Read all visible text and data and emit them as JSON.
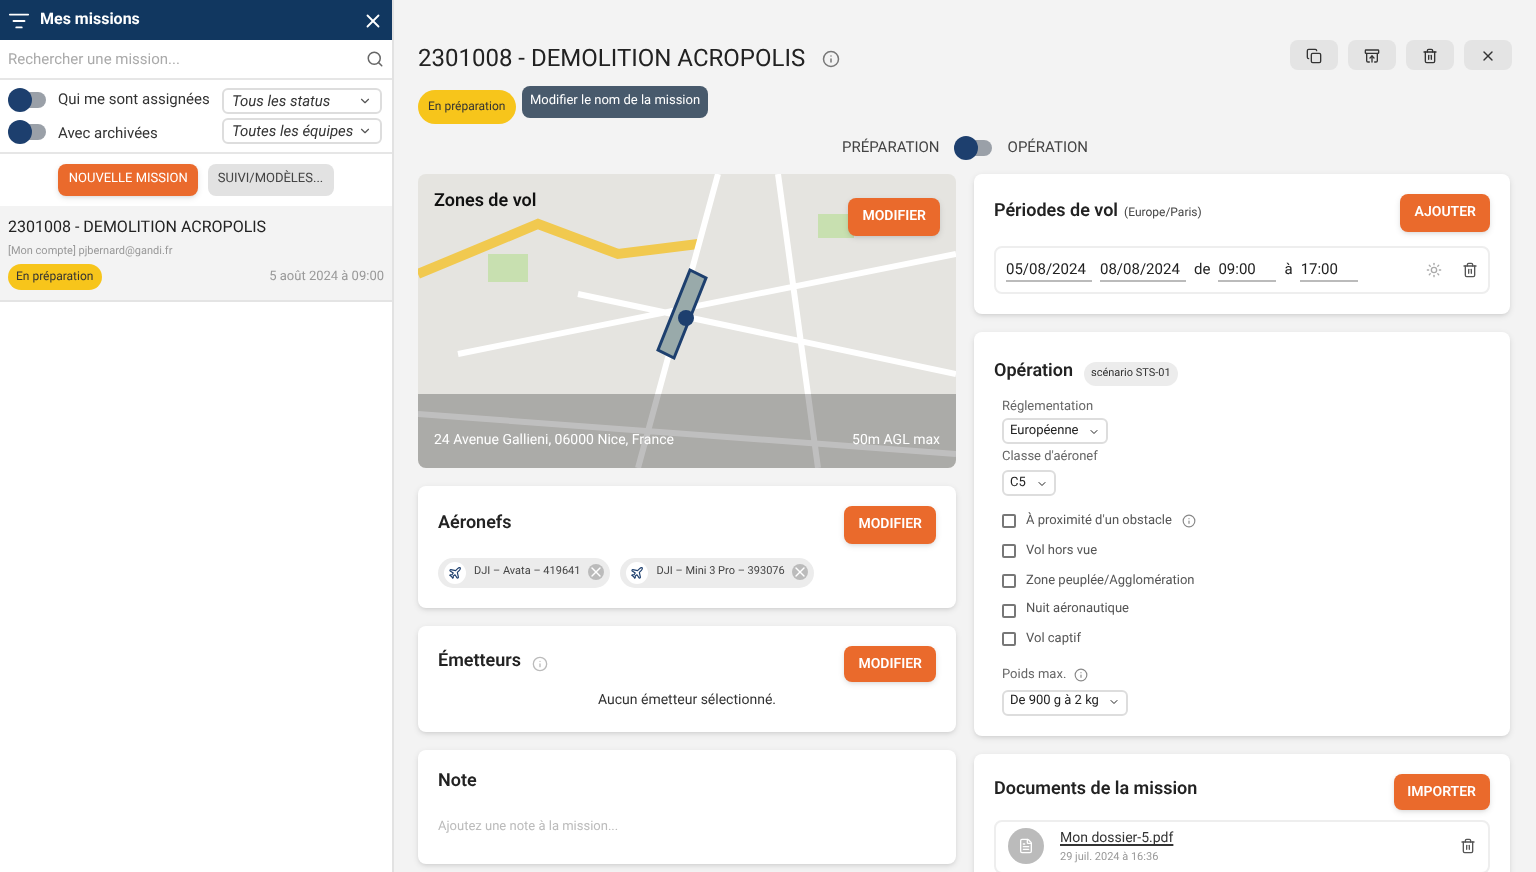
{
  "sidebar": {
    "title": "Mes missions",
    "search": {
      "placeholder": "Rechercher une mission..."
    },
    "toggles": [
      {
        "label": "Qui me sont assignées",
        "on": false
      },
      {
        "label": "Avec archivées",
        "on": false
      }
    ],
    "filters": [
      {
        "value": "Tous les status"
      },
      {
        "value": "Toutes les équipes"
      }
    ],
    "buttons": [
      {
        "label": "NOUVELLE MISSION",
        "kind": "primary"
      },
      {
        "label": "SUIVI/MODÈLES...",
        "kind": "secondary"
      }
    ],
    "missions": [
      {
        "title": "2301008 - DEMOLITION ACROPOLIS",
        "owner": "[Mon compte] pjbernard@gandi.fr",
        "status": "En préparation",
        "date": "5 août 2024 à 09:00",
        "selected": true
      }
    ]
  },
  "mission": {
    "title": "2301008 - DEMOLITION ACROPOLIS",
    "status": "En préparation",
    "tooltip": "Modifier le nom de la mission",
    "mode_switch": {
      "left_label": "PRÉPARATION",
      "right_label": "OPÉRATION",
      "on": false
    }
  },
  "zones": {
    "title": "Zones de vol",
    "button": "MODIFIER",
    "address": "24 Avenue Gallieni, 06000 Nice, France",
    "altitude": "50m AGL max"
  },
  "aircraft": {
    "title": "Aéronefs",
    "button": "MODIFIER",
    "items": [
      {
        "label": "DJI – Avata – 419641"
      },
      {
        "label": "DJI – Mini 3 Pro – 393076"
      }
    ]
  },
  "emitters": {
    "title": "Émetteurs",
    "button": "MODIFIER",
    "empty": "Aucun émetteur sélectionné."
  },
  "note": {
    "title": "Note",
    "placeholder": "Ajoutez une note à la mission..."
  },
  "periods": {
    "title": "Périodes de vol",
    "timezone": "(Europe/Paris)",
    "button": "AJOUTER",
    "rows": [
      {
        "start": "05/08/2024",
        "end": "08/08/2024",
        "from_label": "de",
        "from": "09:00",
        "to_label": "à",
        "to": "17:00"
      }
    ]
  },
  "operation": {
    "title": "Opération",
    "scenario": "scénario STS-01",
    "selects": [
      {
        "label": "Réglementation",
        "value": "Européenne"
      },
      {
        "label": "Classe d'aéronef",
        "value": "C5"
      }
    ],
    "options": [
      {
        "label": "À proximité d'un obstacle",
        "checked": false,
        "info": true
      },
      {
        "label": "Vol hors vue",
        "checked": false,
        "info": false
      },
      {
        "label": "Zone peuplée/Agglomération",
        "checked": false,
        "info": false
      },
      {
        "label": "Nuit aéronautique",
        "checked": false,
        "info": false
      },
      {
        "label": "Vol captif",
        "checked": false,
        "info": false
      }
    ],
    "weight": {
      "label": "Poids max.",
      "value": "De 900 g à 2 kg"
    }
  },
  "documents": {
    "title": "Documents de la mission",
    "button": "IMPORTER",
    "files": [
      {
        "name": "Mon dossier-5.pdf",
        "date": "29 juil. 2024 à 16:36"
      }
    ]
  }
}
